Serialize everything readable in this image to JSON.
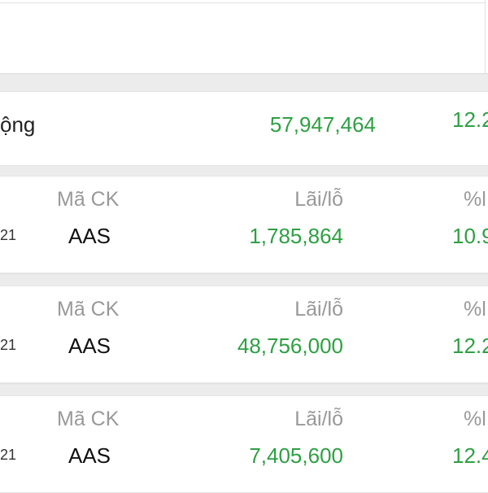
{
  "summary": {
    "label_fragment": "ộng",
    "value": "57,947,464",
    "pct_fragment": "12.2"
  },
  "cards": [
    {
      "date_fragment": "21",
      "code_header": "Mã CK",
      "pl_header": "Lãi/lỗ",
      "pct_header": "%l",
      "code": "AAS",
      "profit_loss": "1,785,864",
      "pct_fragment": "10.9"
    },
    {
      "date_fragment": "21",
      "code_header": "Mã CK",
      "pl_header": "Lãi/lỗ",
      "pct_header": "%l",
      "code": "AAS",
      "profit_loss": "48,756,000",
      "pct_fragment": "12.2"
    },
    {
      "date_fragment": "21",
      "code_header": "Mã CK",
      "pl_header": "Lãi/lỗ",
      "pct_header": "%l",
      "code": "AAS",
      "profit_loss": "7,405,600",
      "pct_fragment": "12.4"
    }
  ],
  "colors": {
    "positive": "#2ea043",
    "header_text": "#999999",
    "body_text": "#111111",
    "background": "#ececec"
  }
}
